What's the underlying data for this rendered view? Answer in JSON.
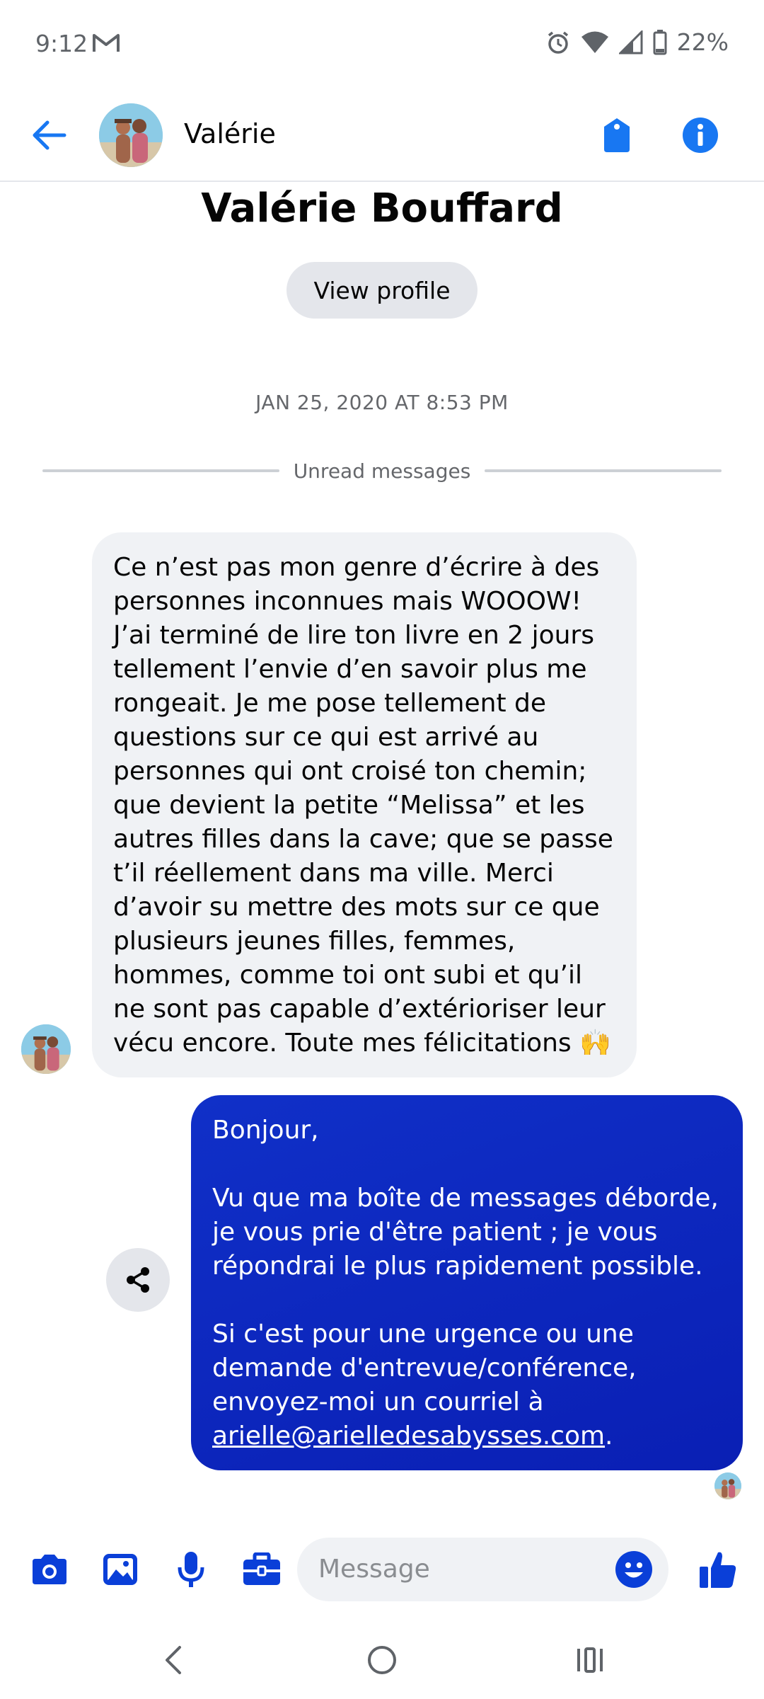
{
  "status_bar": {
    "time": "9:12",
    "battery": "22%",
    "icons": [
      "gmail-icon",
      "alarm-icon",
      "wifi-icon",
      "signal-icon",
      "battery-icon"
    ]
  },
  "header": {
    "contact_short_name": "Valérie",
    "icons": [
      "back-arrow-icon",
      "tag-icon",
      "info-icon"
    ]
  },
  "profile": {
    "full_name": "Valérie Bouffard",
    "view_profile_label": "View profile"
  },
  "conversation": {
    "timestamp": "JAN 25, 2020 AT 8:53 PM",
    "unread_label": "Unread messages",
    "incoming_message": "Ce n’est pas mon genre d’écrire à des personnes inconnues mais WOOOW! J’ai terminé de lire ton livre en 2 jours tellement l’envie d’en savoir plus me rongeait. Je me pose tellement de questions sur ce qui est arrivé au personnes qui ont croisé ton chemin; que devient la petite “Melissa” et les autres filles dans la cave; que se passe t’il réellement dans ma ville. Merci d’avoir su mettre des mots sur ce que plusieurs jeunes filles, femmes, hommes, comme toi ont subi et qu’il ne sont pas capable d’extérioriser leur vécu encore. Toute mes félicitations 🙌",
    "outgoing_message": {
      "line1": "Bonjour,",
      "para2": "Vu que ma boîte de messages déborde, je vous prie d'être patient ; je vous répondrai le plus rapidement possible.",
      "para3": "Si c'est pour une urgence ou une demande d'entrevue/conférence, envoyez-moi un courriel à",
      "email": "arielle@arielledesabysses.com",
      "trailing": "."
    }
  },
  "composer": {
    "placeholder": "Message",
    "icons": [
      "camera-icon",
      "image-icon",
      "microphone-icon",
      "briefcase-icon",
      "emoji-icon",
      "thumbs-up-icon"
    ]
  },
  "colors": {
    "accent": "#0a3fd8",
    "outgoing_bubble": "#0a1fb4",
    "incoming_bubble": "#f0f2f5"
  }
}
